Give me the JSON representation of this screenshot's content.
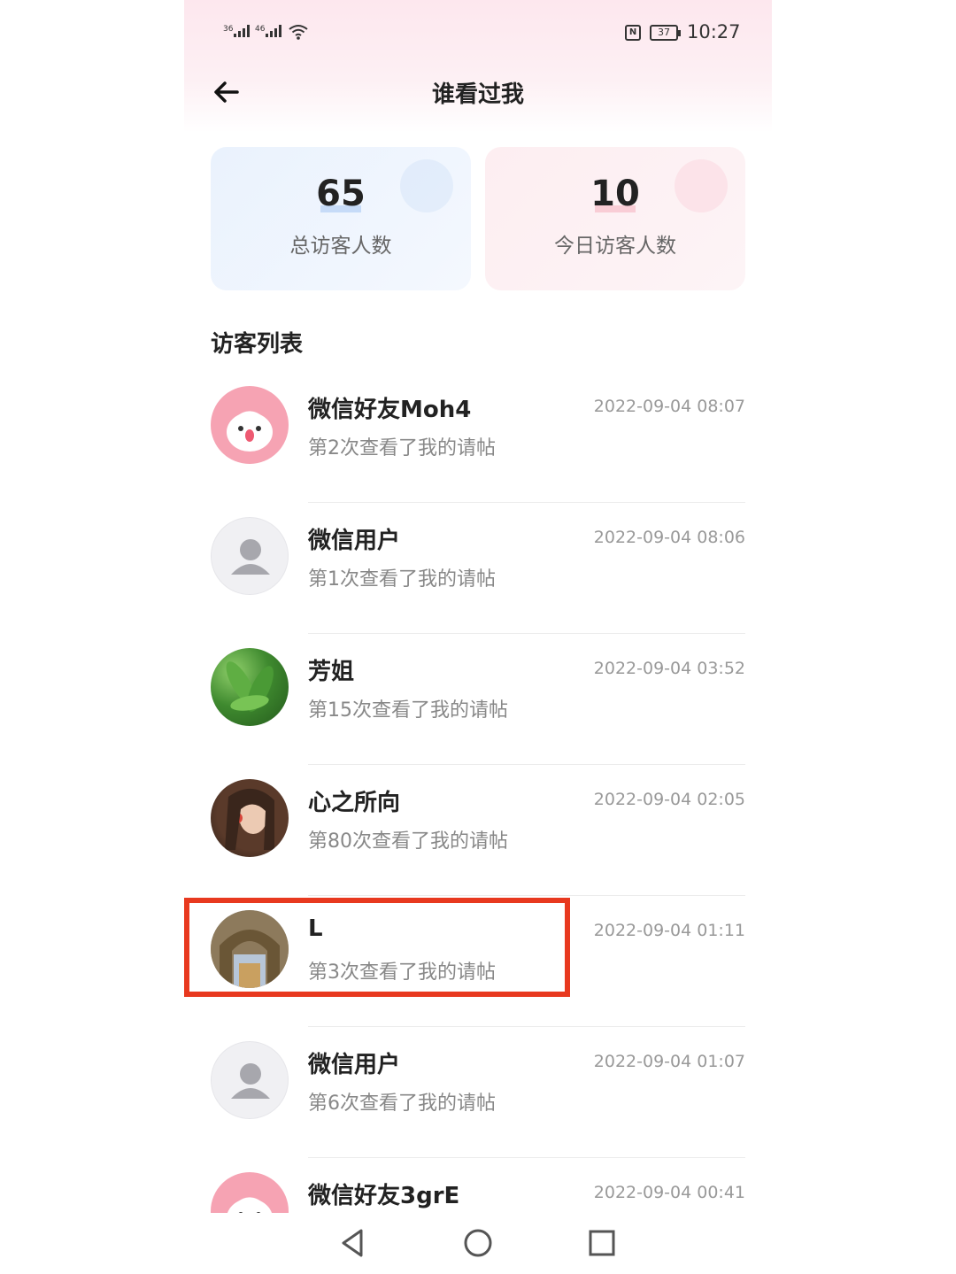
{
  "status_bar": {
    "sim1": "36",
    "sim2": "46",
    "battery": "37",
    "time": "10:27"
  },
  "header": {
    "title": "谁看过我",
    "back_icon": "arrow-left-icon"
  },
  "stats": {
    "total": {
      "value": "65",
      "label": "总访客人数"
    },
    "today": {
      "value": "10",
      "label": "今日访客人数"
    }
  },
  "section_title": "访客列表",
  "visitors": [
    {
      "name": "微信好友Moh4",
      "views": "第2次查看了我的请帖",
      "time": "2022-09-04 08:07",
      "avatar": "pink-pig-avatar"
    },
    {
      "name": "微信用户",
      "views": "第1次查看了我的请帖",
      "time": "2022-09-04 08:06",
      "avatar": "default-avatar"
    },
    {
      "name": "芳姐",
      "views": "第15次查看了我的请帖",
      "time": "2022-09-04 03:52",
      "avatar": "leaf-avatar"
    },
    {
      "name": "心之所向",
      "views": "第80次查看了我的请帖",
      "time": "2022-09-04 02:05",
      "avatar": "girl-avatar"
    },
    {
      "name": "L",
      "views": "第3次查看了我的请帖",
      "time": "2022-09-04 01:11",
      "avatar": "arch-avatar"
    },
    {
      "name": "微信用户",
      "views": "第6次查看了我的请帖",
      "time": "2022-09-04 01:07",
      "avatar": "default-avatar"
    },
    {
      "name": "微信好友3grE",
      "views": "",
      "time": "2022-09-04 00:41",
      "avatar": "pink-pig-avatar"
    }
  ],
  "nav": {
    "back": "triangle-back-icon",
    "home": "circle-home-icon",
    "recents": "square-recents-icon"
  },
  "colors": {
    "highlight": "#e8391f",
    "accent_blue": "#eaf2fd",
    "accent_pink": "#fdeef1"
  }
}
